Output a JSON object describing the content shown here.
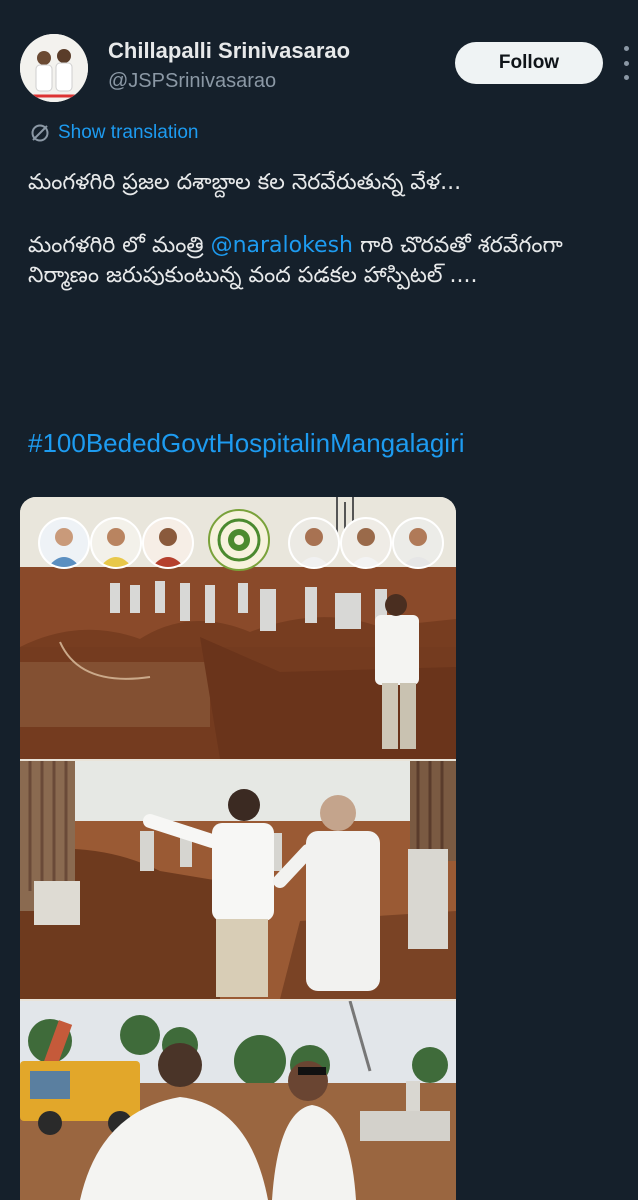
{
  "author": {
    "display_name": "Chillapalli Srinivasarao",
    "handle": "@JSPSrinivasarao"
  },
  "actions": {
    "follow_label": "Follow",
    "more_icon": "more-icon",
    "show_translation_label": "Show translation",
    "translate_icon": "globe-icon"
  },
  "post": {
    "line1": "మంగళగిరి ప్రజల దశాబ్దాల కల నెరవేరుతున్న వేళ...",
    "para2_prefix": "మంగళగిరి లో మంత్రి ",
    "para2_mention": "@naralokesh",
    "para2_suffix": " గారి చొరవతో శరవేగంగా నిర్మాణం జరుపుకుంటున్న వంద పడకల హాస్పిటల్ ....",
    "hashtag": "#100BededGovtHospitalinMangalagiri"
  },
  "colors": {
    "background": "#15202b",
    "link": "#1d9bf0",
    "secondary_text": "#8b98a5",
    "follow_button": "#eff3f4"
  },
  "media": {
    "panels": [
      "site-inspection-photo-1",
      "site-inspection-photo-2",
      "site-inspection-photo-3"
    ]
  }
}
